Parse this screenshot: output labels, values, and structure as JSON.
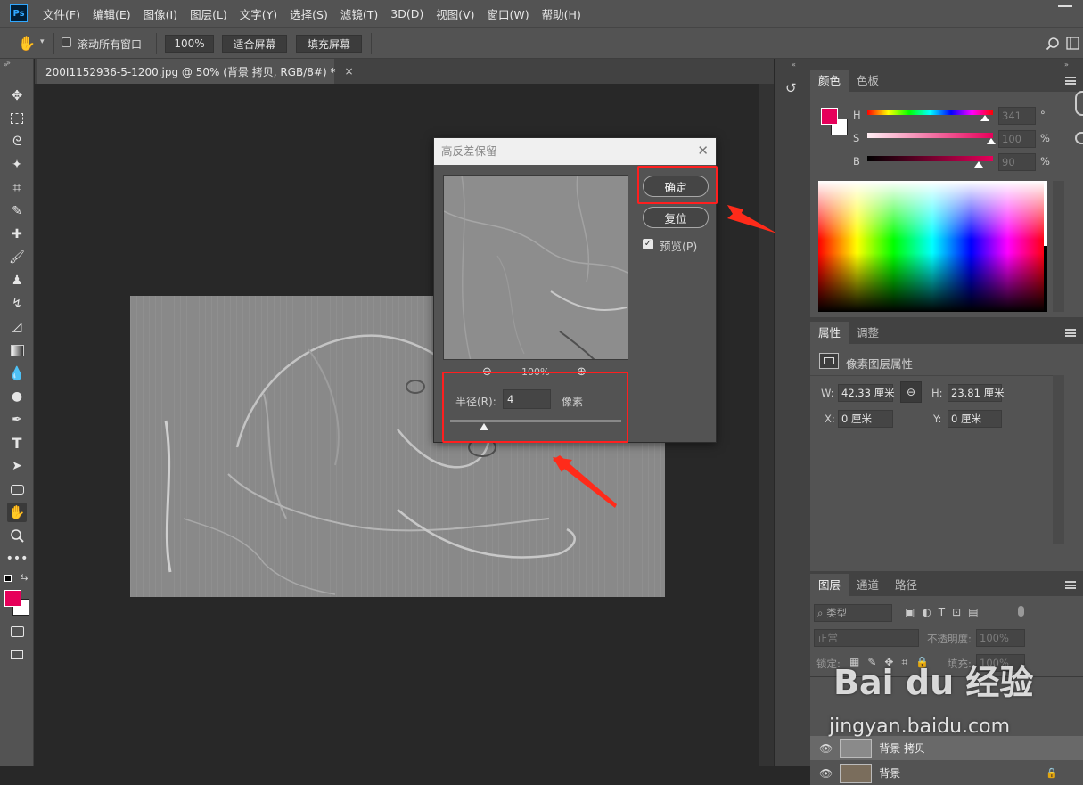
{
  "app": {
    "logo": "Ps"
  },
  "menu": [
    "文件(F)",
    "编辑(E)",
    "图像(I)",
    "图层(L)",
    "文字(Y)",
    "选择(S)",
    "滤镜(T)",
    "3D(D)",
    "视图(V)",
    "窗口(W)",
    "帮助(H)"
  ],
  "options": {
    "scroll_all": "滚动所有窗口",
    "zoom": "100%",
    "fit_screen": "适合屏幕",
    "fill_screen": "填充屏幕"
  },
  "document": {
    "tab_title": "200I1152936-5-1200.jpg @ 50% (背景 拷贝, RGB/8#) *",
    "close": "×"
  },
  "dialog": {
    "title": "高反差保留",
    "ok": "确定",
    "reset": "复位",
    "preview_label": "预览(P)",
    "preview_checked": true,
    "zoom": "100%",
    "radius_label": "半径(R):",
    "radius_value": "4",
    "unit": "像素",
    "slider_fraction": 0.2
  },
  "color_panel": {
    "tabs": [
      "颜色",
      "色板"
    ],
    "h_label": "H",
    "s_label": "S",
    "b_label": "B",
    "h": "341",
    "s": "100",
    "b": "90",
    "deg": "°",
    "pct": "%",
    "fg": "#e6005a"
  },
  "properties_panel": {
    "tabs": [
      "属性",
      "调整"
    ],
    "subtitle": "像素图层属性",
    "w_label": "W:",
    "w": "42.33 厘米",
    "h_label": "H:",
    "h": "23.81 厘米",
    "x_label": "X:",
    "x": "0 厘米",
    "y_label": "Y:",
    "y": "0 厘米"
  },
  "layers_panel": {
    "tabs": [
      "图层",
      "通道",
      "路径"
    ],
    "filter": "类型",
    "blend": "正常",
    "opacity_label": "不透明度:",
    "opacity": "100%",
    "lock_label": "锁定:",
    "fill_label": "填充:",
    "fill": "100%",
    "layers": [
      {
        "name": "背景 拷贝"
      },
      {
        "name": "背景"
      }
    ]
  },
  "watermark": {
    "text": "Bai du 经验",
    "url": "jingyan.baidu.com"
  }
}
